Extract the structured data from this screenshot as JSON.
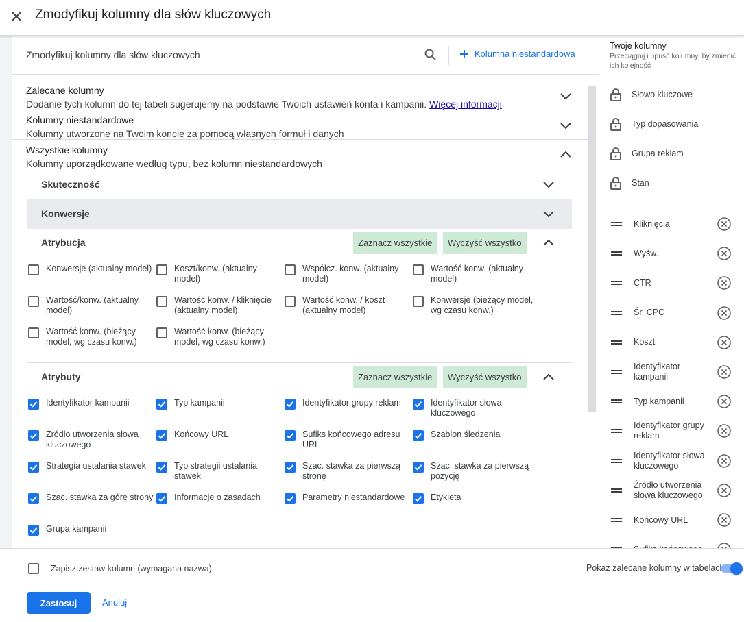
{
  "header": {
    "title": "Zmodyfikuj kolumny dla słów kluczowych"
  },
  "search_bar": {
    "title": "Zmodyfikuj kolumny dla słów kluczowych",
    "add_custom_column": "Kolumna niestandardowa"
  },
  "sections": {
    "recommended": {
      "title": "Zalecane kolumny",
      "description": "Dodanie tych kolumn do tej tabeli sugerujemy na podstawie Twoich ustawień konta i kampanii.",
      "link": "Więcej informacji"
    },
    "custom": {
      "title": "Kolumny niestandardowe",
      "description": "Kolumny utworzone na Twoim koncie za pomocą własnych formuł i danych"
    },
    "all": {
      "title": "Wszystkie kolumny",
      "description": "Kolumny uporządkowane według typu, bez kolumn niestandardowych"
    }
  },
  "categories": {
    "performance": "Skuteczność",
    "conversions": "Konwersje"
  },
  "groups": {
    "select_all": "Zaznacz wszystkie",
    "clear_all": "Wyczyść wszystko",
    "attribution": {
      "title": "Atrybucja",
      "items": [
        {
          "label": "Konwersje (aktualny model)",
          "checked": false
        },
        {
          "label": "Koszt/konw. (aktualny model)",
          "checked": false
        },
        {
          "label": "Współcz. konw. (aktualny model)",
          "checked": false
        },
        {
          "label": "Wartość konw. (aktualny model)",
          "checked": false
        },
        {
          "label": "Wartość/konw. (aktualny model)",
          "checked": false
        },
        {
          "label": "Wartość konw. / kliknięcie (aktualny model)",
          "checked": false
        },
        {
          "label": "Wartość konw. / koszt (aktualny model)",
          "checked": false
        },
        {
          "label": "Konwersje (bieżący model, wg czasu konw.)",
          "checked": false
        },
        {
          "label": "Wartość konw. (bieżący model, wg czasu konw.)",
          "checked": false
        },
        {
          "label": "Wartość konw. (bieżący model, wg czasu konw.)",
          "checked": false
        }
      ]
    },
    "attributes": {
      "title": "Atrybuty",
      "items": [
        {
          "label": "Identyfikator kampanii",
          "checked": true
        },
        {
          "label": "Typ kampanii",
          "checked": true
        },
        {
          "label": "Identyfikator grupy reklam",
          "checked": true
        },
        {
          "label": "Identyfikator słowa kluczowego",
          "checked": true
        },
        {
          "label": "Źródło utworzenia słowa kluczowego",
          "checked": true
        },
        {
          "label": "Końcowy URL",
          "checked": true
        },
        {
          "label": "Sufiks końcowego adresu URL",
          "checked": true
        },
        {
          "label": "Szablon śledzenia",
          "checked": true
        },
        {
          "label": "Strategia ustalania stawek",
          "checked": true
        },
        {
          "label": "Typ strategii ustalania stawek",
          "checked": true
        },
        {
          "label": "Szac. stawka za pierwszą stronę",
          "checked": true
        },
        {
          "label": "Szac. stawka za pierwszą pozycję",
          "checked": true
        },
        {
          "label": "Szac. stawka za górę strony",
          "checked": true
        },
        {
          "label": "Informacje o zasadach",
          "checked": true
        },
        {
          "label": "Parametry niestandardowe",
          "checked": true
        },
        {
          "label": "Etykieta",
          "checked": true
        },
        {
          "label": "Grupa kampanii",
          "checked": true
        }
      ]
    }
  },
  "your_columns": {
    "title": "Twoje kolumny",
    "subtitle": "Przeciągnij i upuść kolumny, by zmienić ich kolejność",
    "locked": [
      "Słowo kluczowe",
      "Typ dopasowania",
      "Grupa reklam",
      "Stan"
    ],
    "columns": [
      "Kliknięcia",
      "Wyśw.",
      "CTR",
      "Śr. CPC",
      "Koszt",
      "Identyfikator kampanii",
      "Typ kampanii",
      "Identyfikator grupy reklam",
      "Identyfikator słowa kluczowego",
      "Źródło utworzenia słowa kluczowego",
      "Końcowy URL",
      "Sufiks końcowego"
    ]
  },
  "footer": {
    "save_set": "Zapisz zestaw kolumn (wymagana nazwa)",
    "show_recommended": "Pokaż zalecane kolumny w tabelach",
    "show_recommended_on": true,
    "apply": "Zastosuj",
    "cancel": "Anuluj"
  },
  "colors": {
    "accent": "#1a73e8",
    "green_button": "#ceead6",
    "section_highlight": "#e8eaed"
  }
}
